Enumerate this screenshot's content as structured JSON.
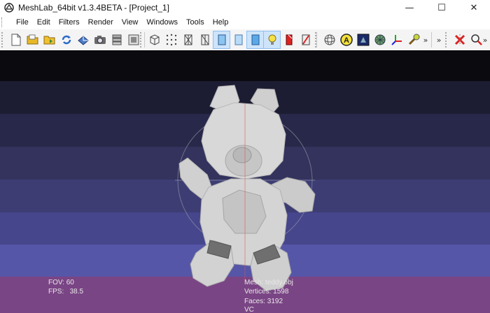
{
  "window": {
    "title": "MeshLab_64bit v1.3.4BETA - [Project_1]",
    "minimize_glyph": "—",
    "maximize_glyph": "☐",
    "close_glyph": "✕"
  },
  "menu": {
    "items": [
      "File",
      "Edit",
      "Filters",
      "Render",
      "View",
      "Windows",
      "Tools",
      "Help"
    ]
  },
  "toolbar": {
    "overflow_glyph": "»"
  },
  "viewport": {
    "fov_label": "FOV:",
    "fov_value": "60",
    "fps_label": "FPS:",
    "fps_value": "38.5",
    "mesh_line": "Mesh: teddy.obj",
    "vertices_line": "Vertices: 1598",
    "faces_line": "Faces: 3192",
    "vc_line": "VC"
  },
  "colors": {
    "bands": [
      "#0a0a0f",
      "#1c1c33",
      "#28284a",
      "#33335d",
      "#3d3d74",
      "#46468c",
      "#5656a8",
      "#6464c3",
      "#7a4585"
    ],
    "accent_active": "#cde4fb",
    "model_fill": "#d4d4d4",
    "model_dark": "#6f6f6f",
    "trackball_red": "#e05050"
  }
}
